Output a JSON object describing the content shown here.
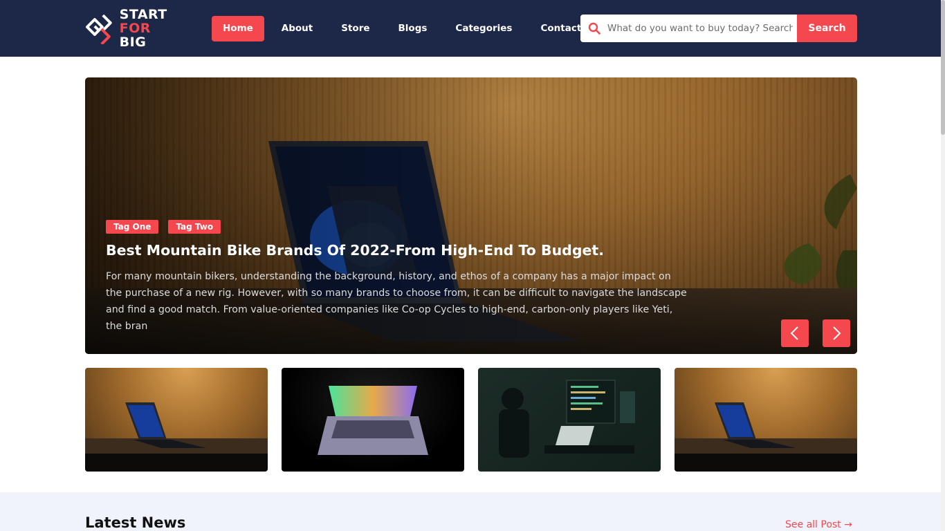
{
  "brand": {
    "line1": "START",
    "line2_a": "FOR",
    "line2_b": "BIG"
  },
  "nav": {
    "items": [
      {
        "label": "Home",
        "active": true
      },
      {
        "label": "About"
      },
      {
        "label": "Store"
      },
      {
        "label": "Blogs"
      },
      {
        "label": "Categories"
      },
      {
        "label": "Contact"
      }
    ]
  },
  "search": {
    "placeholder": "What do you want to buy today? Search",
    "button_label": "Search",
    "icon": "search-icon"
  },
  "hero": {
    "tags": [
      "Tag One",
      "Tag Two"
    ],
    "title": "Best Mountain Bike Brands Of 2022-From High-End To Budget.",
    "description": "For many mountain bikers, understanding the background, history, and ethos of a company has a major impact on the purchase of a new rig. However, with so many brands to choose from, it can be difficult to navigate the landscape and find a good match. From value-oriented companies like Co-op Cycles to high-end, carbon-only players like Yeti, the bran",
    "prev_icon": "chevron-left-icon",
    "next_icon": "chevron-right-icon"
  },
  "thumbnails": [
    "laptop-on-wood",
    "glowing-laptop",
    "programmer-at-monitors",
    "laptop-on-wood"
  ],
  "latest_news": {
    "title": "Latest News",
    "see_all": "See all Post →"
  },
  "colors": {
    "accent": "#f4484e",
    "header_bg": "#1d2748",
    "section_bg": "#f0f3fc"
  }
}
